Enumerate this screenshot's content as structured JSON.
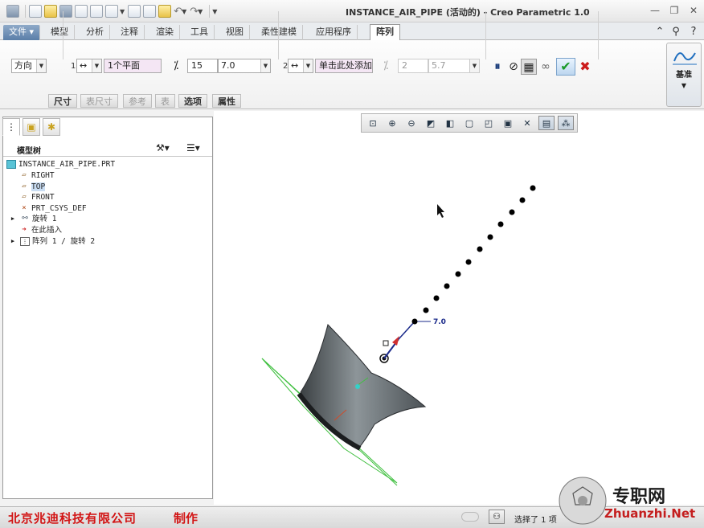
{
  "window": {
    "title": "INSTANCE_AIR_PIPE (活动的) - Creo Parametric 1.0",
    "controls": [
      "—",
      "❐",
      "✕"
    ]
  },
  "tabs": {
    "file": "文件",
    "items": [
      "模型",
      "分析",
      "注释",
      "渲染",
      "工具",
      "视图",
      "柔性建模",
      "应用程序"
    ],
    "active": "阵列"
  },
  "ribbon": {
    "pattern_type": "方向",
    "dir1": {
      "index": "1",
      "ref": "1个平面",
      "count": "15",
      "spacing": "7.0"
    },
    "dir2": {
      "index": "2",
      "ref": "单击此处添加",
      "count": "2",
      "spacing": "5.7"
    },
    "subtabs": [
      "尺寸",
      "表尺寸",
      "参考",
      "表",
      "选项",
      "属性"
    ],
    "datum_label": "基准"
  },
  "tree": {
    "header": "模型树",
    "items": [
      {
        "label": "INSTANCE_AIR_PIPE.PRT",
        "icon": "part-icon"
      },
      {
        "label": "RIGHT",
        "icon": "datum-plane-icon"
      },
      {
        "label": "TOP",
        "icon": "datum-plane-icon"
      },
      {
        "label": "FRONT",
        "icon": "datum-plane-icon"
      },
      {
        "label": "PRT_CSYS_DEF",
        "icon": "csys-icon"
      },
      {
        "label": "旋转 1",
        "icon": "revolve-icon"
      },
      {
        "label": "在此插入",
        "icon": "insert-arrow-icon"
      },
      {
        "label": "阵列 1 / 旋转 2",
        "icon": "pattern-icon"
      }
    ]
  },
  "viewport": {
    "dimension_label": "7.0"
  },
  "status": {
    "company": "北京兆迪科技有限公司",
    "made": "制作",
    "selection": "选择了 1 项"
  },
  "watermark": {
    "text": "专职网",
    "url": "Zhuanzhi.Net"
  }
}
